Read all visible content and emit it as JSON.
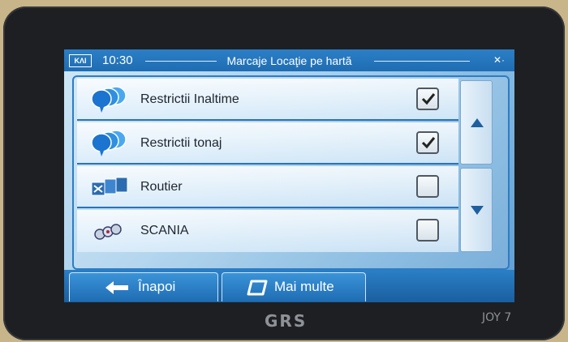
{
  "statusbar": {
    "logo": "ΚΛΙ",
    "time": "10:30",
    "title": "Marcaje Locaţie pe hartă",
    "icons": "✕·"
  },
  "list": {
    "items": [
      {
        "label": "Restrictii Inaltime",
        "checked": true,
        "icon": "blue-balloons-icon"
      },
      {
        "label": "Restrictii tonaj",
        "checked": true,
        "icon": "blue-balloons-icon"
      },
      {
        "label": "Routier",
        "checked": false,
        "icon": "routier-icon"
      },
      {
        "label": "SCANIA",
        "checked": false,
        "icon": "scania-icon"
      }
    ]
  },
  "buttons": {
    "back_label": "Înapoi",
    "more_label": "Mai multe"
  },
  "device": {
    "brand": "GRS",
    "model": "JOY 7"
  },
  "colors": {
    "accent": "#1f6db3",
    "bezel": "#1d1f22"
  }
}
